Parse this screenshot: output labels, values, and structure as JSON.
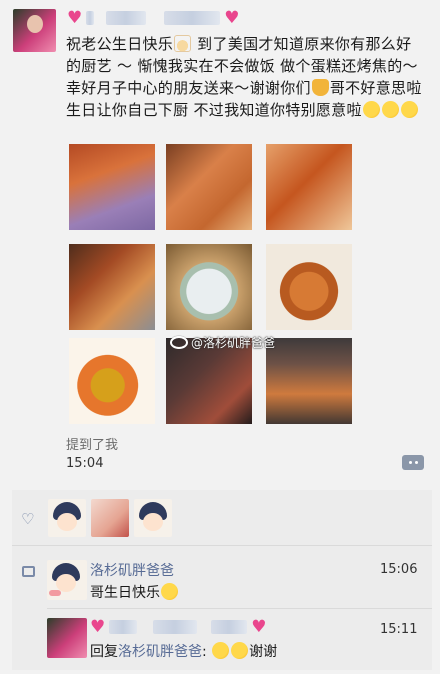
{
  "post": {
    "text_parts": [
      "祝老公生日快乐",
      " 到了美国才知道原来你有那么好的厨艺 ～ 惭愧我实在不会做饭 做个蛋糕还烤焦的～幸好月子中心的朋友送来～谢谢你们",
      "哥不好意思啦 生日让你自己下厨 不过我知道你特别愿意啦"
    ],
    "emoji": {
      "cake": "birthday-cake-emoji",
      "cat": "cat-emoji",
      "kiss": "kissing-face-emoji"
    },
    "watermark": "@洛杉矶胖爸爸",
    "mention": "提到了我",
    "time": "15:04"
  },
  "likes": {
    "icon": "heart-outline-icon"
  },
  "comments": [
    {
      "name": "洛杉矶胖爸爸",
      "time": "15:06",
      "text": "哥生日快乐"
    },
    {
      "time": "15:11",
      "reply_prefix": "回复",
      "reply_to": "洛杉矶胖爸爸",
      "reply_sep": ":",
      "text": "谢谢"
    }
  ],
  "colors": {
    "link": "#576b95",
    "heart": "#e9468d",
    "background": "#f2f2f2",
    "feedback_bg": "#ececec"
  }
}
